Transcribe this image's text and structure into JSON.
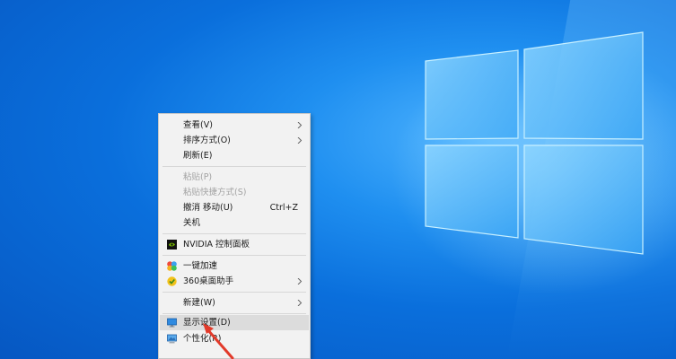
{
  "colors": {
    "desktop": "#0a6fdc",
    "menu_bg": "#f2f2f2",
    "menu_text": "#1b1b1b",
    "menu_disabled": "#a3a3a3",
    "hover_bg": "#dcdcdc",
    "annotation_arrow": "#e23a2a"
  },
  "context_menu": {
    "view": "查看(V)",
    "sort_by": "排序方式(O)",
    "refresh": "刷新(E)",
    "paste": "粘贴(P)",
    "paste_shortcut": "粘贴快捷方式(S)",
    "undo_move": "撤消 移动(U)",
    "undo_move_shortcut": "Ctrl+Z",
    "shutdown": "关机",
    "nvidia": "NVIDIA 控制面板",
    "one_click_accelerate": "一键加速",
    "desktop_assistant": "360桌面助手",
    "new": "新建(W)",
    "display_settings": "显示设置(D)",
    "personalize": "个性化(R)"
  },
  "icons": {
    "nvidia": "nvidia-icon",
    "accelerate": "accelerate-icon",
    "assistant": "360-assistant-icon",
    "display": "display-icon",
    "personalize": "personalize-icon"
  }
}
